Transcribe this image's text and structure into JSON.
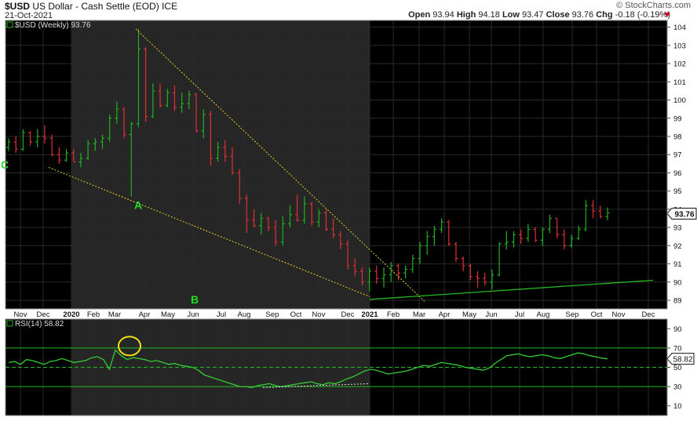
{
  "header": {
    "symbol": "$USD",
    "name": "US Dollar - Cash Settle (EOD)",
    "exchange": "ICE",
    "date": "21-Oct-2021",
    "brand": "© StockCharts.com",
    "open_label": "Open",
    "open": "93.94",
    "high_label": "High",
    "high": "94.18",
    "low_label": "Low",
    "low": "93.47",
    "close_label": "Close",
    "close": "93.76",
    "chg_label": "Chg",
    "chg": "-0.18 (-0.19%)"
  },
  "colors": {
    "background": "#000000",
    "shaded_region": "#262626",
    "up_bar": "#22b022",
    "down_bar": "#e03030",
    "trendline_yellow": "#e8d020",
    "support_line": "#22bb22",
    "rsi_line": "#33cc33",
    "wave_label": "#22dd22",
    "grid": "#2a2a2a",
    "highlight_circle": "#f0e010"
  },
  "chart_data": [
    {
      "type": "ohlc",
      "title": "$USD (Weekly) 93.76",
      "series_name": "$USD (Weekly)",
      "last_value": "93.76",
      "last_value_label": "93.76",
      "ylim": [
        88.7,
        104.2
      ],
      "y_ticks": [
        "89",
        "90",
        "91",
        "92",
        "93",
        "94",
        "95",
        "96",
        "97",
        "98",
        "99",
        "100",
        "101",
        "102",
        "103",
        "104"
      ],
      "x_labels": [
        "Nov",
        "Dec",
        "2020",
        "Feb",
        "Mar",
        "Apr",
        "May",
        "Jun",
        "Jul",
        "Aug",
        "Sep",
        "Oct",
        "Nov",
        "Dec",
        "2021",
        "Feb",
        "Mar",
        "Apr",
        "May",
        "Jun",
        "Jul",
        "Aug",
        "Sep",
        "Oct",
        "Nov",
        "Dec"
      ],
      "bars": [
        [
          97.4,
          97.9,
          97.2,
          97.7
        ],
        [
          97.7,
          98.0,
          97.1,
          97.3
        ],
        [
          97.3,
          98.4,
          97.2,
          98.2
        ],
        [
          98.2,
          98.3,
          97.5,
          97.7
        ],
        [
          97.7,
          98.4,
          97.4,
          98.0
        ],
        [
          98.0,
          98.6,
          97.6,
          97.9
        ],
        [
          97.9,
          98.1,
          96.9,
          97.0
        ],
        [
          97.0,
          97.4,
          96.5,
          96.7
        ],
        [
          96.7,
          97.3,
          96.6,
          97.1
        ],
        [
          97.1,
          97.3,
          96.6,
          96.6
        ],
        [
          96.6,
          97.1,
          96.3,
          96.8
        ],
        [
          96.8,
          97.8,
          96.7,
          97.6
        ],
        [
          97.6,
          97.9,
          97.2,
          97.7
        ],
        [
          97.7,
          98.1,
          97.3,
          97.9
        ],
        [
          97.9,
          99.2,
          97.7,
          99.0
        ],
        [
          99.0,
          99.9,
          98.7,
          99.5
        ],
        [
          99.5,
          99.6,
          97.9,
          98.1
        ],
        [
          98.1,
          98.8,
          94.7,
          98.7
        ],
        [
          98.7,
          103.9,
          98.5,
          102.8
        ],
        [
          102.8,
          102.9,
          98.8,
          99.1
        ],
        [
          99.1,
          100.9,
          99.0,
          100.5
        ],
        [
          100.5,
          100.9,
          99.6,
          99.7
        ],
        [
          99.7,
          100.6,
          99.6,
          100.4
        ],
        [
          100.4,
          100.8,
          99.4,
          99.6
        ],
        [
          99.6,
          100.4,
          99.3,
          99.8
        ],
        [
          99.8,
          100.5,
          99.5,
          100.3
        ],
        [
          100.3,
          100.4,
          98.2,
          98.3
        ],
        [
          98.3,
          99.5,
          97.9,
          99.2
        ],
        [
          99.2,
          99.4,
          96.4,
          96.8
        ],
        [
          96.8,
          97.7,
          96.6,
          97.4
        ],
        [
          97.4,
          97.8,
          96.6,
          96.9
        ],
        [
          96.9,
          97.4,
          95.9,
          96.0
        ],
        [
          96.0,
          96.2,
          94.3,
          94.6
        ],
        [
          94.6,
          94.8,
          92.7,
          93.4
        ],
        [
          93.4,
          94.0,
          93.0,
          93.1
        ],
        [
          93.1,
          93.8,
          92.6,
          93.5
        ],
        [
          93.5,
          93.6,
          92.8,
          93.0
        ],
        [
          93.0,
          93.4,
          92.0,
          92.2
        ],
        [
          92.2,
          93.6,
          92.0,
          93.2
        ],
        [
          93.2,
          94.2,
          93.0,
          93.7
        ],
        [
          93.7,
          94.8,
          93.3,
          93.4
        ],
        [
          93.4,
          94.7,
          93.2,
          94.3
        ],
        [
          94.3,
          94.4,
          93.1,
          93.3
        ],
        [
          93.3,
          94.0,
          93.0,
          93.8
        ],
        [
          93.8,
          94.0,
          92.8,
          92.9
        ],
        [
          92.9,
          93.5,
          92.4,
          92.6
        ],
        [
          92.6,
          92.8,
          91.8,
          92.1
        ],
        [
          92.1,
          92.3,
          90.7,
          90.9
        ],
        [
          90.9,
          91.3,
          90.3,
          90.6
        ],
        [
          90.6,
          90.8,
          89.8,
          90.0
        ],
        [
          90.0,
          90.8,
          89.5,
          90.6
        ],
        [
          90.6,
          90.9,
          89.9,
          90.2
        ],
        [
          90.2,
          90.8,
          89.7,
          90.4
        ],
        [
          90.4,
          91.1,
          90.0,
          90.9
        ],
        [
          90.9,
          91.0,
          90.1,
          90.5
        ],
        [
          90.5,
          90.9,
          90.2,
          90.7
        ],
        [
          90.7,
          91.5,
          90.5,
          91.3
        ],
        [
          91.3,
          92.2,
          91.0,
          92.0
        ],
        [
          92.0,
          92.8,
          91.5,
          92.5
        ],
        [
          92.5,
          93.1,
          92.0,
          92.9
        ],
        [
          92.9,
          93.5,
          92.7,
          93.3
        ],
        [
          93.3,
          93.4,
          92.0,
          92.1
        ],
        [
          92.1,
          92.2,
          91.1,
          91.3
        ],
        [
          91.3,
          91.4,
          90.6,
          90.9
        ],
        [
          90.9,
          91.0,
          90.1,
          90.3
        ],
        [
          90.3,
          90.6,
          89.7,
          90.2
        ],
        [
          90.2,
          90.5,
          89.8,
          90.0
        ],
        [
          90.0,
          90.7,
          89.6,
          90.4
        ],
        [
          90.4,
          92.2,
          90.3,
          92.1
        ],
        [
          92.1,
          92.8,
          91.8,
          92.2
        ],
        [
          92.2,
          92.8,
          91.9,
          92.6
        ],
        [
          92.6,
          92.9,
          92.1,
          92.4
        ],
        [
          92.4,
          93.2,
          92.2,
          92.9
        ],
        [
          92.9,
          93.0,
          92.2,
          92.3
        ],
        [
          92.3,
          93.0,
          92.0,
          92.9
        ],
        [
          92.9,
          93.7,
          92.7,
          93.5
        ],
        [
          93.5,
          93.5,
          92.4,
          92.6
        ],
        [
          92.6,
          92.9,
          91.8,
          92.0
        ],
        [
          92.0,
          92.6,
          91.9,
          92.4
        ],
        [
          92.4,
          93.1,
          92.3,
          92.9
        ],
        [
          92.9,
          94.5,
          92.8,
          94.2
        ],
        [
          94.2,
          94.5,
          93.5,
          93.9
        ],
        [
          93.9,
          94.2,
          93.5,
          93.6
        ],
        [
          93.6,
          94.1,
          93.4,
          93.8
        ]
      ],
      "support_line": {
        "x_labels": [
          "2021",
          "Dec"
        ],
        "y": [
          89.05,
          90.1
        ]
      },
      "wedge_upper": {
        "x_labels": [
          "Mar",
          "Mar"
        ],
        "y": [
          103.9,
          88.9
        ]
      },
      "wedge_lower": {
        "x_labels": [
          "Dec",
          "2021"
        ],
        "y": [
          96.3,
          89.2
        ]
      },
      "annotations": [
        {
          "text": "A",
          "x_label": "Apr",
          "y": 94.2
        },
        {
          "text": "B",
          "x_label": "Jun",
          "y": 89.0
        },
        {
          "text": "C",
          "x_label": "Nov",
          "y": 96.4
        }
      ],
      "shaded_from": "2020",
      "shaded_to": "2021"
    },
    {
      "type": "line",
      "title": "RSI(14) 58.82",
      "series_name": "RSI(14)",
      "last_value": "58.82",
      "last_value_label": "58.82",
      "ylim": [
        0,
        100
      ],
      "y_ticks": [
        "10",
        "30",
        "50",
        "70",
        "90"
      ],
      "reference_lines": [
        70,
        50,
        30
      ],
      "values": [
        55,
        56,
        53,
        58,
        57,
        55,
        53,
        56,
        57,
        59,
        57,
        55,
        56,
        57,
        60,
        61,
        58,
        48,
        68,
        62,
        58,
        60,
        59,
        58,
        56,
        57,
        55,
        53,
        54,
        52,
        51,
        50,
        47,
        42,
        40,
        38,
        36,
        34,
        32,
        30,
        30,
        29,
        31,
        32,
        33,
        31,
        30,
        31,
        32,
        33,
        34,
        35,
        33,
        32,
        34,
        33,
        35,
        38,
        40,
        43,
        46,
        48,
        47,
        45,
        43,
        44,
        45,
        46,
        48,
        50,
        52,
        51,
        53,
        55,
        54,
        53,
        52,
        50,
        49,
        48,
        47,
        49,
        54,
        58,
        62,
        63,
        64,
        62,
        61,
        62,
        63,
        62,
        60,
        59,
        61,
        63,
        65,
        64,
        62,
        61,
        59.5,
        58.8
      ],
      "divergence": {
        "x_labels": [
          "Aug",
          "2021"
        ],
        "y": [
          29,
          33
        ]
      },
      "highlight": {
        "x_label": "Mar",
        "y": 68
      }
    }
  ]
}
